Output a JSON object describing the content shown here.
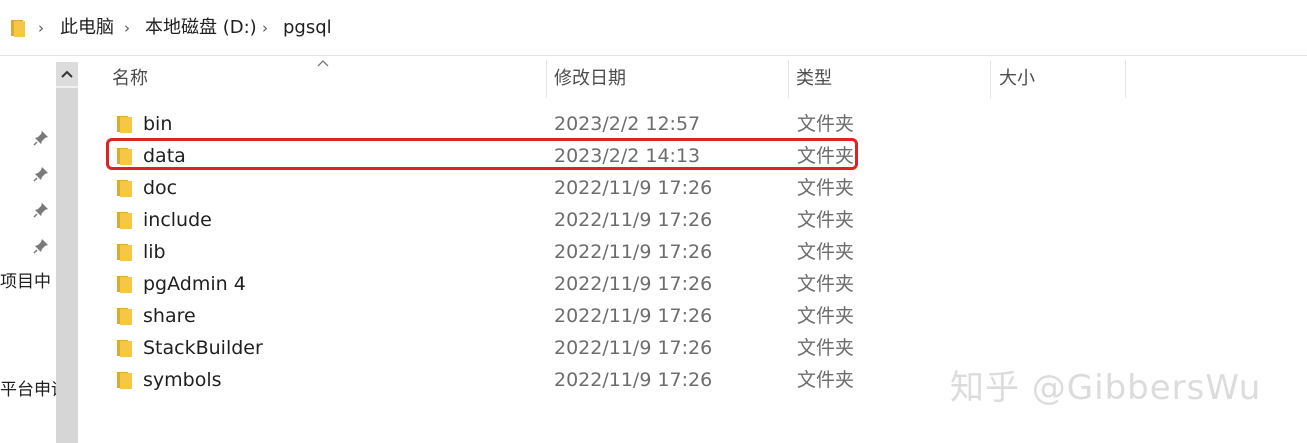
{
  "addressbar": {
    "crumbs": [
      "此电脑",
      "本地磁盘 (D:)",
      "pgsql"
    ]
  },
  "columns": {
    "name": "名称",
    "date": "修改日期",
    "type": "类型",
    "size": "大小"
  },
  "nav": {
    "item1": "项目中",
    "item2": "平台申请"
  },
  "files": [
    {
      "name": "bin",
      "date": "2023/2/2 12:57",
      "type": "文件夹"
    },
    {
      "name": "data",
      "date": "2023/2/2 14:13",
      "type": "文件夹",
      "highlighted": true
    },
    {
      "name": "doc",
      "date": "2022/11/9 17:26",
      "type": "文件夹"
    },
    {
      "name": "include",
      "date": "2022/11/9 17:26",
      "type": "文件夹"
    },
    {
      "name": "lib",
      "date": "2022/11/9 17:26",
      "type": "文件夹"
    },
    {
      "name": "pgAdmin 4",
      "date": "2022/11/9 17:26",
      "type": "文件夹"
    },
    {
      "name": "share",
      "date": "2022/11/9 17:26",
      "type": "文件夹"
    },
    {
      "name": "StackBuilder",
      "date": "2022/11/9 17:26",
      "type": "文件夹"
    },
    {
      "name": "symbols",
      "date": "2022/11/9 17:26",
      "type": "文件夹"
    }
  ],
  "watermark": "知乎 @GibbersWu",
  "colors": {
    "folder": "#f5c744",
    "folder_dark": "#e0a92a",
    "highlight": "#e12222"
  }
}
